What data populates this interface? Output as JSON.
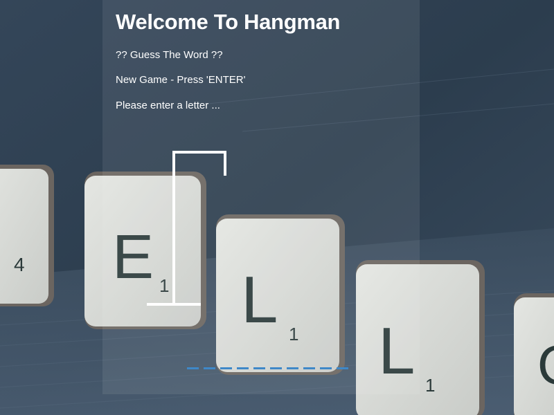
{
  "header": {
    "title": "Welcome To Hangman",
    "subtitle": "?? Guess The Word ??",
    "status": "New Game - Press 'ENTER'",
    "prompt": "Please enter a letter ..."
  },
  "word": {
    "slot_count": 10,
    "slot_color": "#3f88c8"
  },
  "background": {
    "tiles": [
      {
        "letter": "",
        "score": "4"
      },
      {
        "letter": "E",
        "score": "1"
      },
      {
        "letter": "L",
        "score": "1"
      },
      {
        "letter": "L",
        "score": "1"
      },
      {
        "letter": "O",
        "score": ""
      }
    ]
  },
  "colors": {
    "backdrop": "#2f4052",
    "tile_face": "#d9dcd8",
    "gallows": "#ffffff"
  }
}
